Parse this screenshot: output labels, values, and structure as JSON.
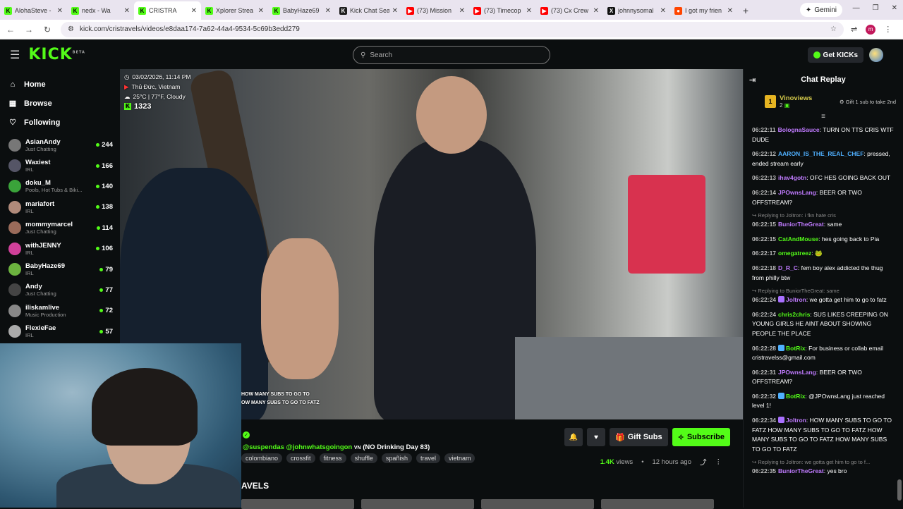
{
  "browser": {
    "tabs": [
      {
        "label": "AlohaSteve -",
        "color": "#53fc18",
        "letter": "K",
        "active": false
      },
      {
        "label": "nedx - Wa",
        "color": "#53fc18",
        "letter": "K",
        "active": false
      },
      {
        "label": "CRISTRA",
        "color": "#53fc18",
        "letter": "K",
        "active": true
      },
      {
        "label": "Xplorer Strea",
        "color": "#53fc18",
        "letter": "K",
        "active": false
      },
      {
        "label": "BabyHaze69",
        "color": "#53fc18",
        "letter": "K",
        "active": false
      },
      {
        "label": "Kick Chat Sea",
        "color": "#1e1e1e",
        "letter": "K",
        "active": false
      },
      {
        "label": "(73) Mission",
        "color": "#ff0000",
        "letter": "▶",
        "active": false
      },
      {
        "label": "(73) Timecop",
        "color": "#ff0000",
        "letter": "▶",
        "active": false
      },
      {
        "label": "(73) Cx Crew",
        "color": "#ff0000",
        "letter": "▶",
        "active": false
      },
      {
        "label": "johnnysomal",
        "color": "#111111",
        "letter": "X",
        "active": false
      },
      {
        "label": "I got my frien",
        "color": "#ff4500",
        "letter": "●",
        "active": false
      }
    ],
    "new_tab": "+",
    "gemini": "Gemini",
    "url": "kick.com/cristravels/videos/e8daa174-7a62-44a4-9534-5c69b3edd279",
    "profile_letter": "m"
  },
  "header": {
    "logo": "KICK",
    "logo_sup": "BETA",
    "search_placeholder": "Search",
    "get_kicks": "Get KICKs"
  },
  "sidebar": {
    "nav": [
      {
        "label": "Home",
        "icon": "⌂"
      },
      {
        "label": "Browse",
        "icon": "▦"
      },
      {
        "label": "Following",
        "icon": "♡"
      }
    ],
    "channels": [
      {
        "name": "AsianAndy",
        "category": "Just Chatting",
        "viewers": "244",
        "color": "#777"
      },
      {
        "name": "Waxiest",
        "category": "IRL",
        "viewers": "166",
        "color": "#556"
      },
      {
        "name": "doku_M",
        "category": "Pools, Hot Tubs & Biki...",
        "viewers": "140",
        "color": "#3aa33a"
      },
      {
        "name": "mariafort",
        "category": "IRL",
        "viewers": "138",
        "color": "#b08a7a"
      },
      {
        "name": "mommymarcel",
        "category": "Just Chatting",
        "viewers": "114",
        "color": "#9a6b5a"
      },
      {
        "name": "withJENNY",
        "category": "IRL",
        "viewers": "106",
        "color": "#d0409a"
      },
      {
        "name": "BabyHaze69",
        "category": "IRL",
        "viewers": "79",
        "color": "#6cb33f"
      },
      {
        "name": "Andy",
        "category": "Just Chatting",
        "viewers": "77",
        "color": "#444"
      },
      {
        "name": "iliskamlive",
        "category": "Music Production",
        "viewers": "72",
        "color": "#888"
      },
      {
        "name": "FlexieFae",
        "category": "IRL",
        "viewers": "57",
        "color": "#aaa"
      }
    ]
  },
  "video": {
    "date": "03/02/2026, 11:14 PM",
    "location": "Thủ Đức, Vietnam",
    "weather": "25°C | 77°F, Cloudy",
    "viewers": "1323",
    "caption_line1": "HOW MANY SUBS TO GO TO",
    "caption_line2": "OW MANY SUBS TO GO TO FATZ"
  },
  "stream_info": {
    "title_mentions": "@suspendas @johnwhatsgoingon",
    "title_flag": "VN",
    "title_rest": "(NO Drinking Day 83)",
    "tags": [
      "colombiano",
      "crossfit",
      "fitness",
      "shuffle",
      "spañish",
      "travel",
      "vietnam"
    ],
    "gift_subs": "Gift Subs",
    "subscribe": "Subscribe",
    "views_count": "1.4K",
    "views_label": "views",
    "time_ago": "12 hours ago",
    "section_title": "AVELS"
  },
  "chat": {
    "title": "Chat Replay",
    "pinned_rank": "1",
    "pinned_user": "Vinoviews",
    "pinned_subs": "2",
    "pinned_gift": "Gift 1 sub to take 2nd",
    "messages": [
      {
        "time": "06:22:11",
        "user": "BolognaSauce",
        "color": "#c07bff",
        "text": "TURN ON TTS CRIS WTF DUDE",
        "reply": ""
      },
      {
        "time": "06:22:12",
        "user": "AARON_IS_THE_REAL_CHEF",
        "color": "#4fb0ff",
        "text": "pressed, ended stream early",
        "reply": ""
      },
      {
        "time": "06:22:13",
        "user": "ihav4gotn",
        "color": "#c07bff",
        "text": "OFC HES GOING BACK OUT",
        "reply": ""
      },
      {
        "time": "06:22:14",
        "user": "JPOwnsLang",
        "color": "#c07bff",
        "text": "BEER OR TWO OFFSTREAM?",
        "reply": ""
      },
      {
        "time": "06:22:15",
        "user": "BuniorTheGreat",
        "color": "#c07bff",
        "text": "same",
        "reply": "Replying to Joltron: i fkn hate cris"
      },
      {
        "time": "06:22:15",
        "user": "CatAndMouse",
        "color": "#53fc18",
        "text": "hes going back to Pia",
        "reply": ""
      },
      {
        "time": "06:22:17",
        "user": "omegatreez",
        "color": "#53fc18",
        "text": "🐸",
        "reply": ""
      },
      {
        "time": "06:22:18",
        "user": "D_R_C",
        "color": "#c07bff",
        "text": "fem boy alex addicted the thug from philly btw",
        "reply": ""
      },
      {
        "time": "06:22:24",
        "user": "Joltron",
        "color": "#c07bff",
        "text": "we gotta get him to go to fatz",
        "reply": "Replying to BuniorTheGreat: same"
      },
      {
        "time": "06:22:24",
        "user": "chris2chris",
        "color": "#53fc18",
        "text": "SUS LIKES CREEPING ON YOUNG GIRLS HE AINT ABOUT SHOWING PEOPLE THE PLACE",
        "reply": ""
      },
      {
        "time": "06:22:28",
        "user": "BotRix",
        "color": "#53fc18",
        "text": "For business or collab email cristravelss@gmail.com",
        "reply": ""
      },
      {
        "time": "06:22:31",
        "user": "JPOwnsLang",
        "color": "#c07bff",
        "text": "BEER OR TWO OFFSTREAM?",
        "reply": ""
      },
      {
        "time": "06:22:32",
        "user": "BotRix",
        "color": "#53fc18",
        "text": "@JPOwnsLang just reached level 1!",
        "reply": ""
      },
      {
        "time": "06:22:34",
        "user": "Joltron",
        "color": "#c07bff",
        "text": "HOW MANY SUBS TO GO TO FATZ HOW MANY SUBS TO GO TO FATZ HOW MANY SUBS TO GO TO FATZ HOW MANY SUBS TO GO TO FATZ",
        "reply": ""
      },
      {
        "time": "06:22:35",
        "user": "BuniorTheGreat",
        "color": "#c07bff",
        "text": "yes bro",
        "reply": "Replying to Joltron: we gotta get him to go to f..."
      }
    ]
  }
}
